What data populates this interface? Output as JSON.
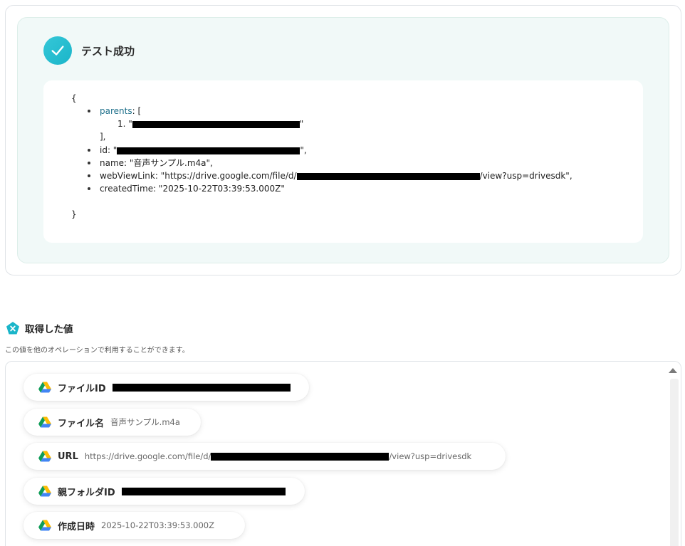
{
  "test_result": {
    "title": "テスト成功",
    "json_output": {
      "open_brace": "{",
      "close_brace": "}",
      "parents_key": "parents",
      "parents_open": ": [",
      "parents_item_prefix": "1. \"",
      "parents_item_suffix": "\"",
      "parents_close": "],",
      "id_prefix": "id: \"",
      "id_suffix": "\",",
      "name_line": "name: \"音声サンプル.m4a\",",
      "webview_prefix": "webViewLink: \"https://drive.google.com/file/d/",
      "webview_suffix": "/view?usp=drivesdk\",",
      "created_line": "createdTime: \"2025-10-22T03:39:53.000Z\""
    }
  },
  "obtained_values": {
    "title": "取得した値",
    "description": "この値を他のオペレーションで利用することができます。",
    "items": [
      {
        "label": "ファイルID",
        "value": "",
        "redacted": true,
        "icon": "google-drive-icon"
      },
      {
        "label": "ファイル名",
        "value": "音声サンプル.m4a",
        "redacted": false,
        "icon": "google-drive-icon"
      },
      {
        "label": "URL",
        "value_prefix": "https://drive.google.com/file/d/",
        "value_suffix": "/view?usp=drivesdk",
        "redacted": true,
        "icon": "google-drive-icon"
      },
      {
        "label": "親フォルダID",
        "value": "",
        "redacted": true,
        "icon": "google-drive-icon"
      },
      {
        "label": "作成日時",
        "value": "2025-10-22T03:39:53.000Z",
        "redacted": false,
        "icon": "google-drive-icon"
      }
    ]
  },
  "colors": {
    "success_accent": "#1ab5c9",
    "panel_bg": "#f1f9f8",
    "json_key": "#1d6f8a"
  }
}
